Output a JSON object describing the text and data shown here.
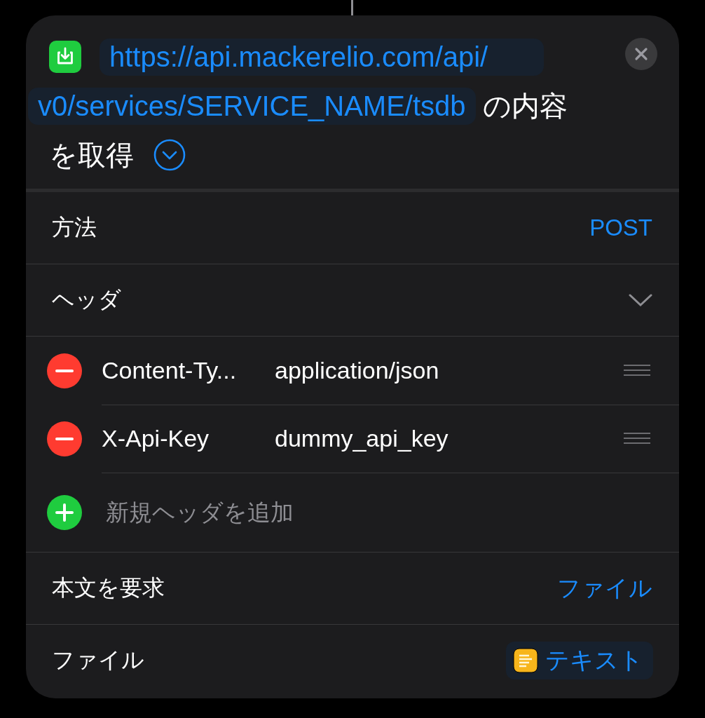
{
  "action": {
    "url_parts": [
      "https://api.mackerelio.com/api/",
      "v0/services/SERVICE_NAME/tsdb"
    ],
    "text_parts": [
      "の内容",
      "を取得"
    ],
    "expanded": false
  },
  "rows": [
    {
      "kind": "value",
      "label": "方法",
      "value": "POST"
    },
    {
      "kind": "section",
      "label": "ヘッダ",
      "expanded": true
    }
  ],
  "headers": [
    {
      "key": "Content-Ty...",
      "value": "application/json"
    },
    {
      "key": "X-Api-Key",
      "value": "dummy_api_key"
    }
  ],
  "add_header": {
    "placeholder": "新規ヘッダを追加"
  },
  "body_rows": [
    {
      "kind": "value",
      "label": "本文を要求",
      "value": "ファイル"
    },
    {
      "kind": "token",
      "label": "ファイル",
      "value": "テキスト"
    }
  ]
}
